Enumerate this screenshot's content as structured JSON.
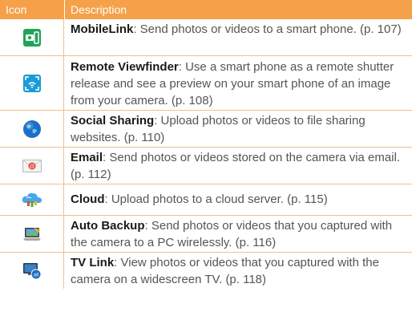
{
  "header": {
    "icon_col": "Icon",
    "description_col": "Description"
  },
  "rows": [
    {
      "icon": "mobilelink-icon",
      "name": "MobileLink",
      "text": ": Send photos or videos to a smart phone. (p. 107)"
    },
    {
      "icon": "remote-viewfinder-icon",
      "name": "Remote Viewfinder",
      "text": ": Use a smart phone as a remote shutter release and see a preview on your smart phone of an image from your camera. (p. 108)"
    },
    {
      "icon": "social-sharing-globe-icon",
      "name": "Social Sharing",
      "text": ": Upload photos or videos to file sharing websites. (p. 110)"
    },
    {
      "icon": "email-envelope-icon",
      "name": "Email",
      "text": ": Send photos or videos stored on the camera via email. (p. 112)"
    },
    {
      "icon": "cloud-icon",
      "name": "Cloud",
      "text": ": Upload photos to a cloud server. (p. 115)"
    },
    {
      "icon": "auto-backup-laptop-icon",
      "name": "Auto Backup",
      "text": ": Send photos or videos that you captured with the camera to a PC wirelessly. (p. 116)"
    },
    {
      "icon": "tv-link-icon",
      "name": "TV Link",
      "text": ": View photos or videos that you captured with the camera on a widescreen TV. (p. 118)"
    }
  ],
  "colors": {
    "header_bg": "#f4a14a",
    "divider": "#f0c089",
    "body_text": "#555555",
    "bold_text": "#1a1a1a"
  }
}
